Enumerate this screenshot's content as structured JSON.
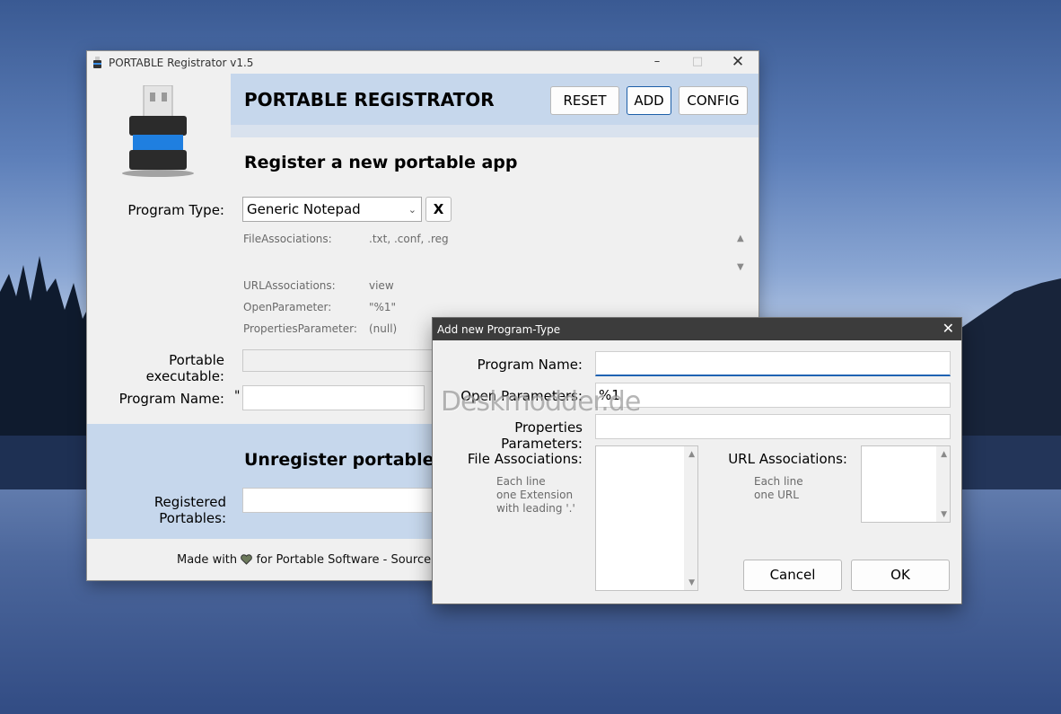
{
  "main_window": {
    "title": "PORTABLE Registrator v1.5",
    "header_title": "PORTABLE REGISTRATOR",
    "buttons": {
      "reset": "RESET",
      "add": "ADD",
      "config": "CONFIG"
    },
    "register_title": "Register a new portable app",
    "program_type_label": "Program Type:",
    "program_type_value": "Generic Notepad",
    "clear_button": "X",
    "info": [
      {
        "label": "FileAssociations:",
        "value": ".txt, .conf, .reg"
      },
      {
        "label": "URLAssociations:",
        "value": "view"
      },
      {
        "label": "OpenParameter:",
        "value": "\"%1\""
      },
      {
        "label": "PropertiesParameter:",
        "value": "(null)"
      }
    ],
    "portable_executable_label": "Portable executable:",
    "program_name_label": "Program Name:",
    "program_name_quote": "\"",
    "unregister_title": "Unregister portable A",
    "registered_portables_label": "Registered Portables:",
    "footer_before": "Made with",
    "footer_after": "for Portable Software - Source co"
  },
  "dialog": {
    "title": "Add new Program-Type",
    "program_name_label": "Program Name:",
    "program_name_value": "",
    "open_parameters_label": "Open Parameters:",
    "open_parameters_value": "%1",
    "properties_parameters_label": "Properties Parameters:",
    "properties_parameters_value": "",
    "file_associations_label": "File Associations:",
    "file_associations_hint": [
      "Each line",
      "one Extension",
      "with leading '.'"
    ],
    "url_associations_label": "URL Associations:",
    "url_associations_hint": [
      "Each line",
      "one URL"
    ],
    "cancel_label": "Cancel",
    "ok_label": "OK"
  },
  "watermark": "Deskmodder.de",
  "icons": [
    "app-usb-icon",
    "minimize-icon",
    "maximize-icon",
    "close-icon",
    "chevron-down-icon",
    "heart-icon",
    "scroll-up-icon",
    "scroll-down-icon"
  ]
}
